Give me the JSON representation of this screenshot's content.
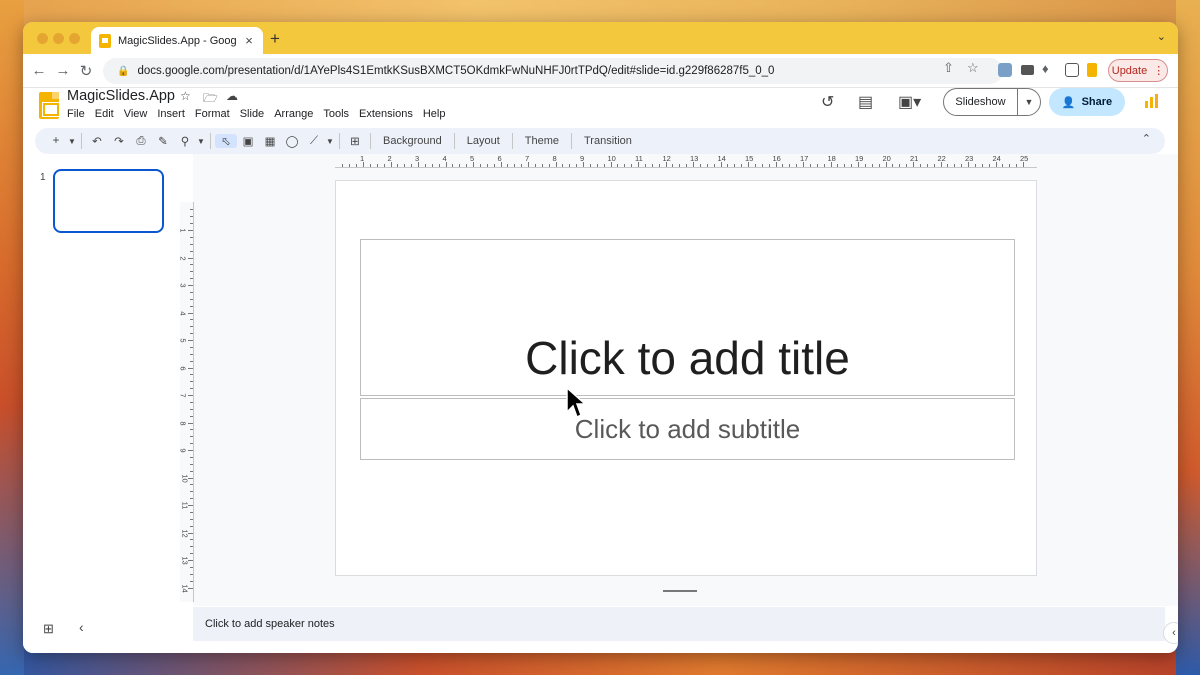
{
  "browser": {
    "tab_title": "MagicSlides.App - Google Slides",
    "tab_close": "×",
    "new_tab": "+",
    "url": "docs.google.com/presentation/d/1AYePls4S1EmtkKSusBXMCT5OKdmkFwNuNHFJ0rtTPdQ/edit#slide=id.g229f86287f5_0_0",
    "update_label": "Update",
    "colors": {
      "tabstrip": "#f3c83d",
      "update_text": "#b3261e"
    }
  },
  "app": {
    "doc_title": "MagicSlides.App",
    "menu": [
      "File",
      "Edit",
      "View",
      "Insert",
      "Format",
      "Slide",
      "Arrange",
      "Tools",
      "Extensions",
      "Help"
    ],
    "slideshow_label": "Slideshow",
    "share_label": "Share"
  },
  "toolbar": {
    "background_label": "Background",
    "layout_label": "Layout",
    "theme_label": "Theme",
    "transition_label": "Transition"
  },
  "ruler": {
    "horizontal": [
      "1",
      "2",
      "3",
      "4",
      "5",
      "6",
      "7",
      "8",
      "9",
      "10",
      "11",
      "12",
      "13",
      "14",
      "15",
      "16",
      "17",
      "18",
      "19",
      "20",
      "21",
      "22",
      "23",
      "24",
      "25"
    ],
    "vertical": [
      "1",
      "2",
      "3",
      "4",
      "5",
      "6",
      "7",
      "8",
      "9",
      "10",
      "11",
      "12",
      "13",
      "14"
    ]
  },
  "filmstrip": {
    "slide_number": "1"
  },
  "slide": {
    "title_placeholder": "Click to add title",
    "subtitle_placeholder": "Click to add subtitle"
  },
  "notes": {
    "placeholder": "Click to add speaker notes"
  }
}
